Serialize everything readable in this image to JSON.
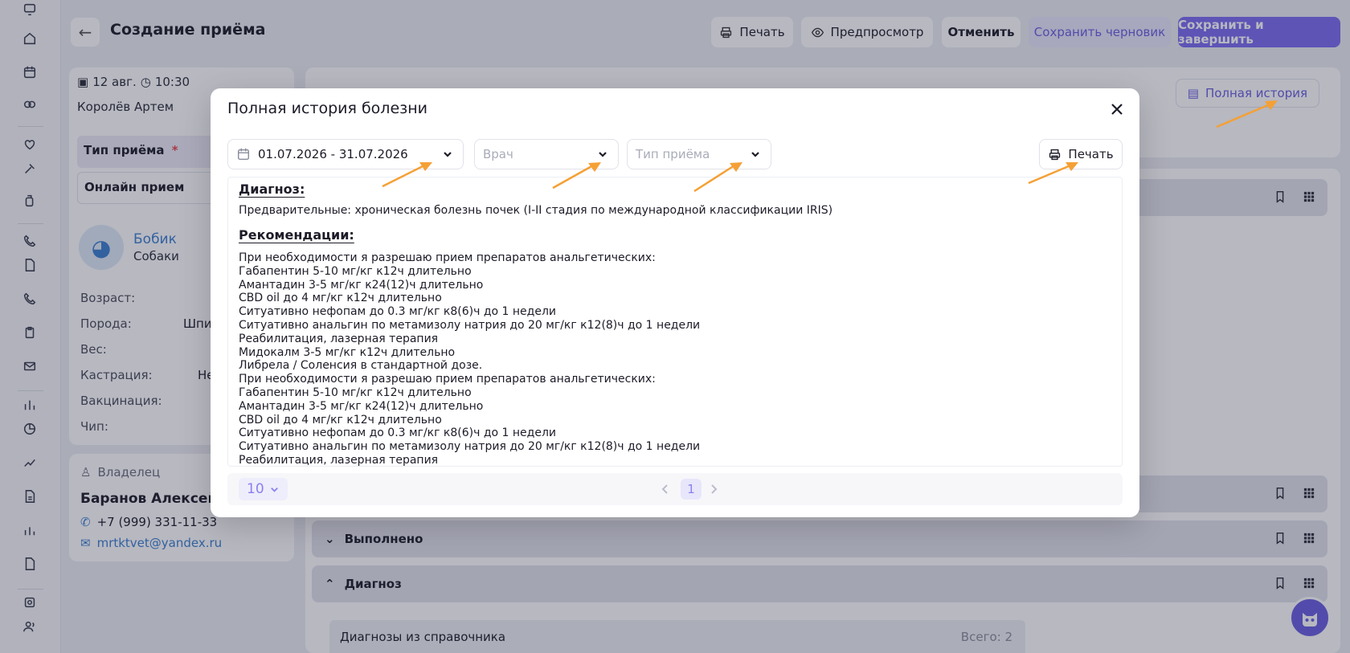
{
  "page": {
    "title": "Создание приёма",
    "toolbar": {
      "print": "Печать",
      "preview": "Предпросмотр",
      "cancel": "Отменить",
      "save_draft": "Сохранить черновик",
      "save_finish": "Сохранить и завершить"
    },
    "full_history_button": "Полная история"
  },
  "visit": {
    "date": "12 авг.",
    "time": "10:30",
    "doctor": "Королёв Артем",
    "type_label": "Тип приёма",
    "required_mark": "*",
    "type_value": "Онлайн прием"
  },
  "patient": {
    "name": "Бобик",
    "species": "Собаки",
    "fields": [
      {
        "label": "Возраст:",
        "value": ""
      },
      {
        "label": "Порода:",
        "value": "Шпи"
      },
      {
        "label": "Вес:",
        "value": ""
      },
      {
        "label": "Кастрация:",
        "value": "Не"
      },
      {
        "label": "Вакцинация:",
        "value": ""
      },
      {
        "label": "Чип:",
        "value": ""
      }
    ]
  },
  "owner": {
    "heading": "Владелец",
    "name": "Баранов Алексей И",
    "phone": "+7 (999) 331-11-33",
    "email": "mrtktvet@yandex.ru"
  },
  "sections": [
    {
      "title": "Выполнено"
    },
    {
      "title": "Диагноз"
    }
  ],
  "diagnosis_panel": {
    "title": "Диагнозы из справочника",
    "total": "Всего: 2"
  },
  "modal": {
    "title": "Полная история болезни",
    "date_range": "01.07.2026 - 31.07.2026",
    "doctor_placeholder": "Врач",
    "visit_type_placeholder": "Тип приёма",
    "print": "Печать",
    "diagnosis_heading": "Диагноз:",
    "diagnosis_text": "Предварительные: хроническая болезнь почек (I-II стадия по международной классификации IRIS)",
    "recommendations_heading": "Рекомендации:",
    "recommendations": [
      "При необходимости я разрешаю прием препаратов анальгетических:",
      "Габапентин 5-10 мг/кг к12ч длительно",
      "Амантадин 3-5 мг/кг к24(12)ч длительно",
      "CBD oil до 4 мг/кг к12ч длительно",
      "Ситуативно нефопам до 0.3 мг/кг к8(6)ч до 1 недели",
      "Ситуативно анальгин по метамизолу натрия до 20 мг/кг к12(8)ч до 1 недели",
      "Реабилитация, лазерная терапия",
      "Мидокалм 3-5 мг/кг к12ч длительно",
      "Либрела / Соленсия в стандартной дозе.",
      "При необходимости я разрешаю прием препаратов анальгетических:",
      "Габапентин 5-10 мг/кг к12ч длительно",
      "Амантадин 3-5 мг/кг к24(12)ч длительно",
      "CBD oil до 4 мг/кг к12ч длительно",
      "Ситуативно нефопам до 0.3 мг/кг к8(6)ч до 1 недели",
      "Ситуативно анальгин по метамизолу натрия до 20 мг/кг к12(8)ч до 1 недели",
      "Реабилитация, лазерная терапия"
    ],
    "page_size": "10",
    "current_page": "1"
  },
  "colors": {
    "accent": "#7b6cf0",
    "annotation_arrow": "#f5a035"
  }
}
